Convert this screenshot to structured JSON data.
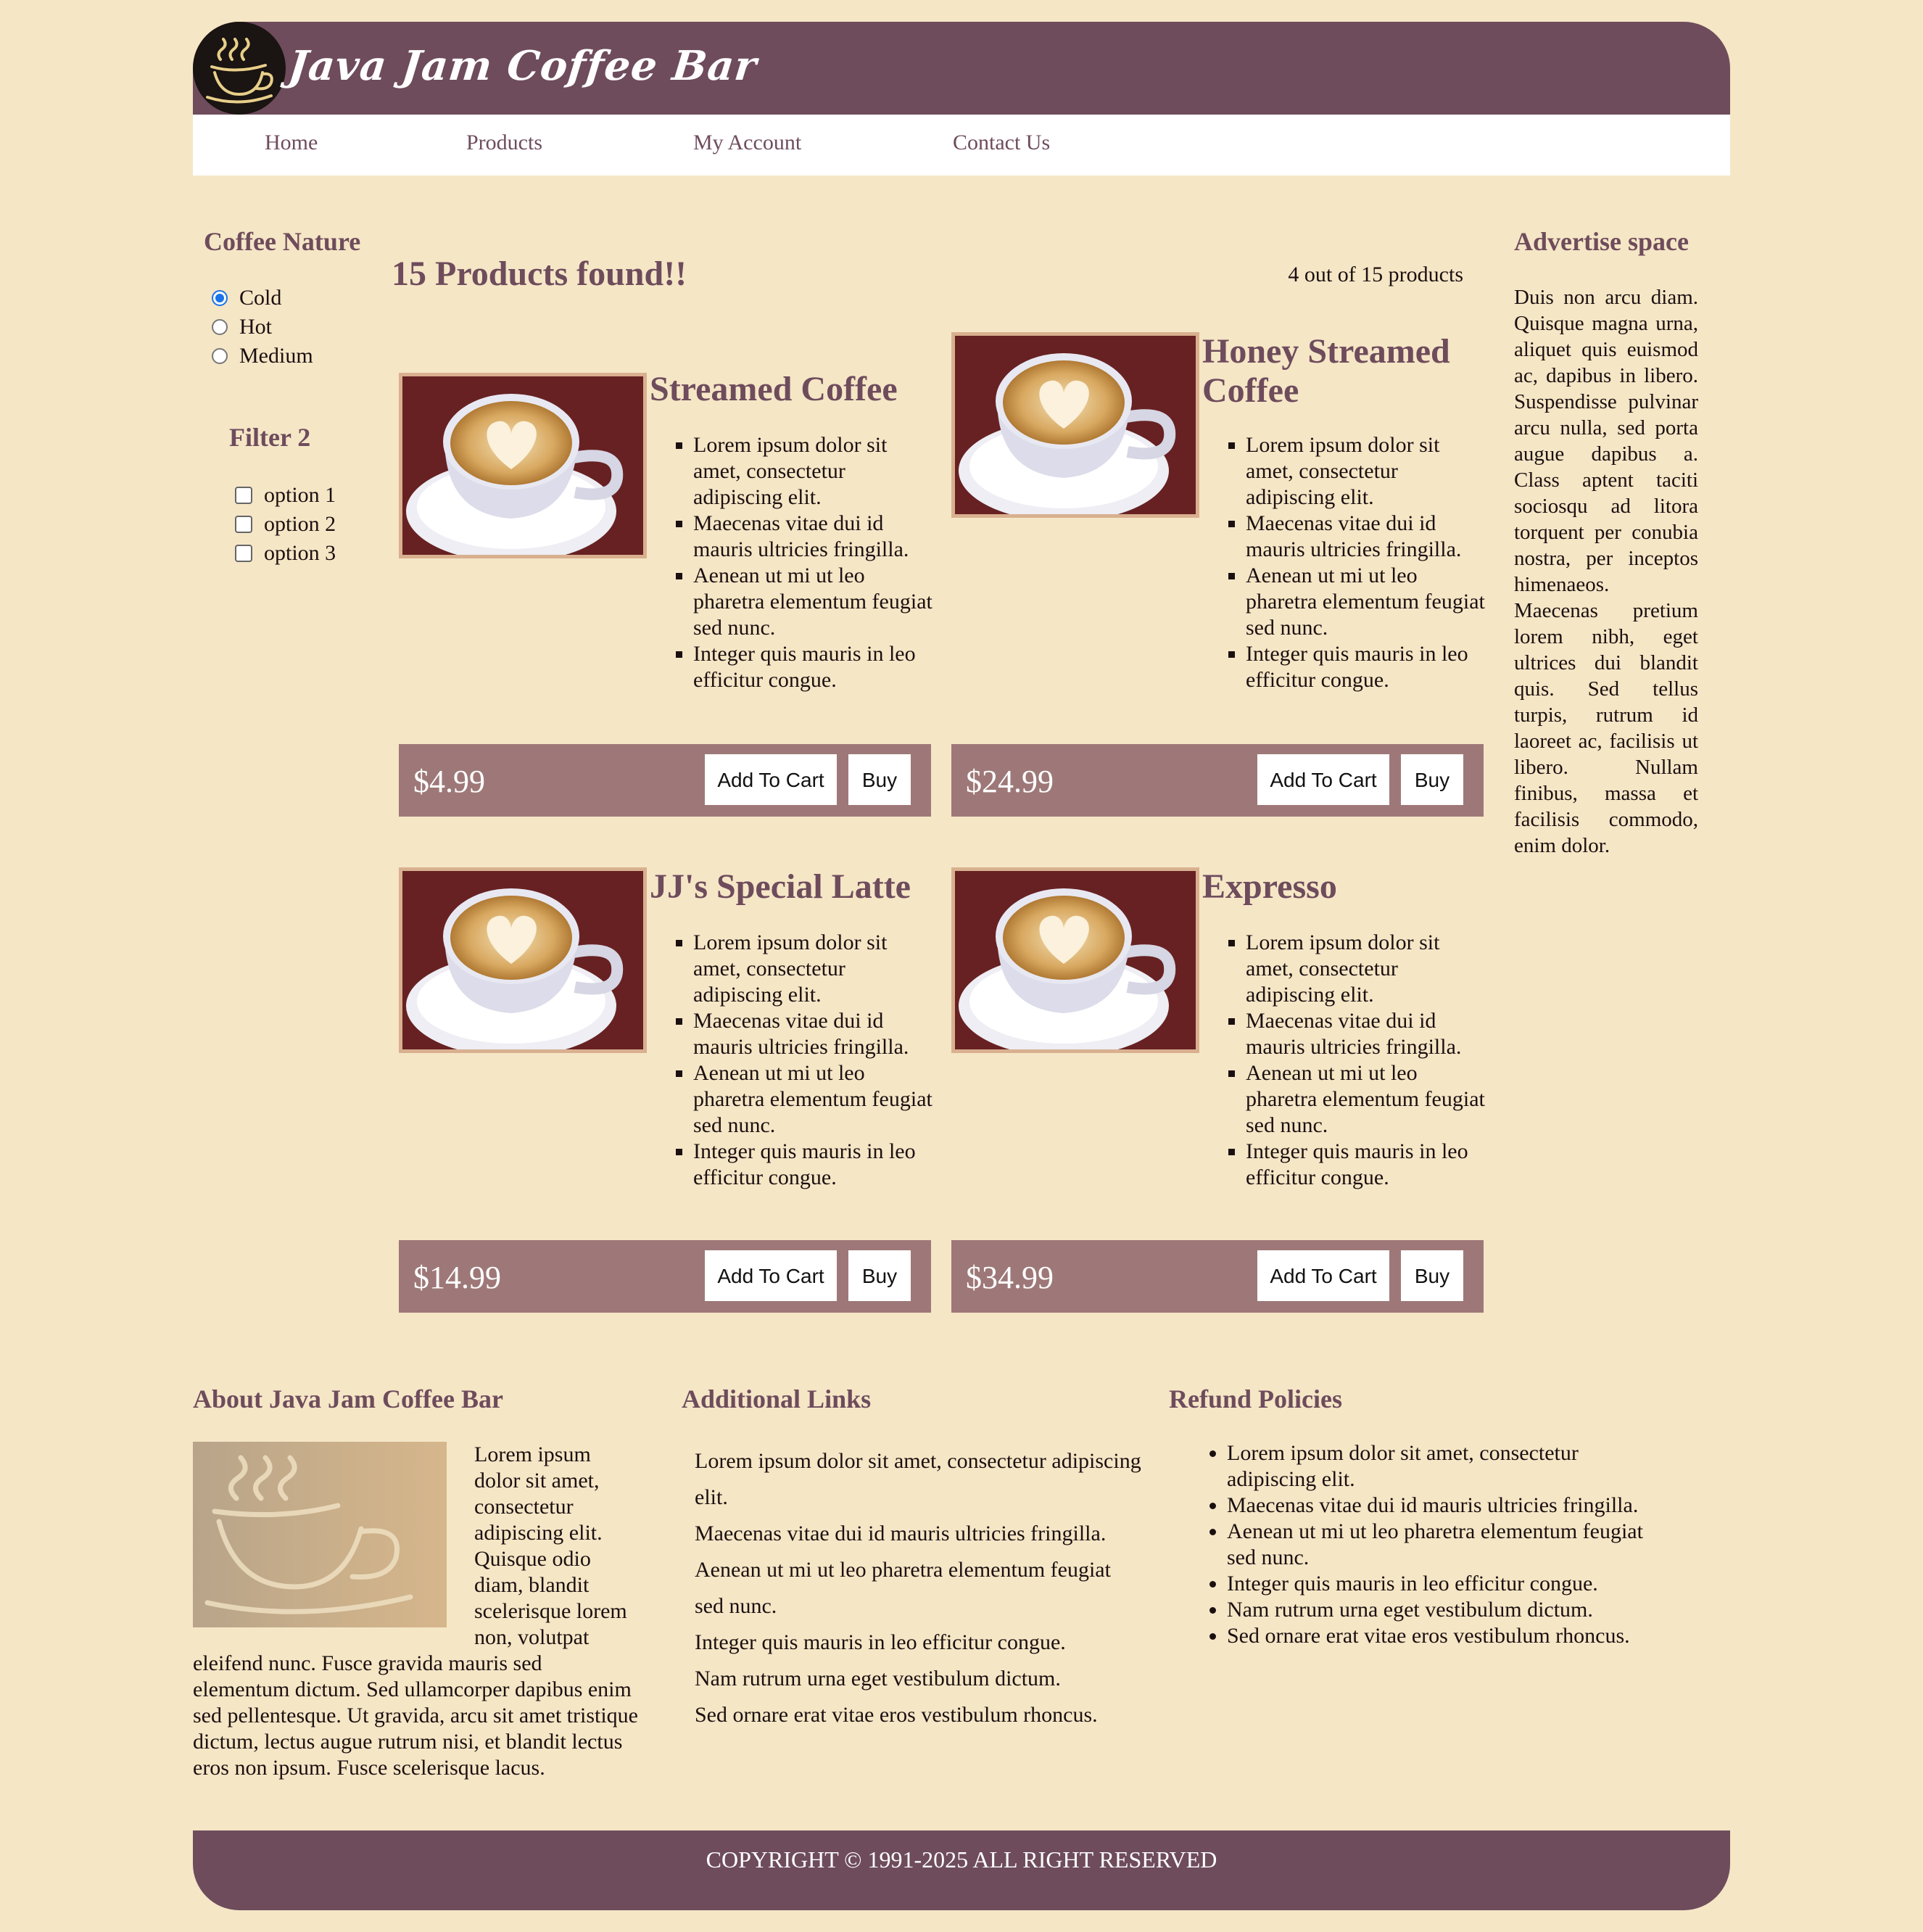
{
  "brand": {
    "title": "Java Jam Coffee Bar"
  },
  "nav": {
    "items": [
      "Home",
      "Products",
      "My Account",
      "Contact Us"
    ]
  },
  "filters": {
    "heading": "Coffee Nature",
    "radios": [
      {
        "label": "Cold",
        "checked": true
      },
      {
        "label": "Hot",
        "checked": false
      },
      {
        "label": "Medium",
        "checked": false
      }
    ],
    "filter2_heading": "Filter 2",
    "checkboxes": [
      {
        "label": "option 1",
        "checked": false
      },
      {
        "label": "option 2",
        "checked": false
      },
      {
        "label": "option 3",
        "checked": false
      }
    ]
  },
  "main": {
    "products_found": "15 Products found!!",
    "products_count": "4 out of 15 products",
    "add_to_cart_label": "Add To Cart",
    "buy_label": "Buy",
    "products": [
      {
        "name": "Streamed Coffee",
        "price": "$4.99",
        "features": [
          "Lorem ipsum dolor sit amet, consectetur adipiscing elit.",
          "Maecenas vitae dui id mauris ultricies fringilla.",
          "Aenean ut mi ut leo pharetra elementum feugiat sed nunc.",
          "Integer quis mauris in leo efficitur congue."
        ]
      },
      {
        "name": "Honey Streamed Coffee",
        "price": "$24.99",
        "features": [
          "Lorem ipsum dolor sit amet, consectetur adipiscing elit.",
          "Maecenas vitae dui id mauris ultricies fringilla.",
          "Aenean ut mi ut leo pharetra elementum feugiat sed nunc.",
          "Integer quis mauris in leo efficitur congue."
        ]
      },
      {
        "name": "JJ's Special Latte",
        "price": "$14.99",
        "features": [
          "Lorem ipsum dolor sit amet, consectetur adipiscing elit.",
          "Maecenas vitae dui id mauris ultricies fringilla.",
          "Aenean ut mi ut leo pharetra elementum feugiat sed nunc.",
          "Integer quis mauris in leo efficitur congue."
        ]
      },
      {
        "name": "Expresso",
        "price": "$34.99",
        "features": [
          "Lorem ipsum dolor sit amet, consectetur adipiscing elit.",
          "Maecenas vitae dui id mauris ultricies fringilla.",
          "Aenean ut mi ut leo pharetra elementum feugiat sed nunc.",
          "Integer quis mauris in leo efficitur congue."
        ]
      }
    ]
  },
  "advert": {
    "heading": "Advertise space",
    "text": "Duis non arcu diam. Quisque magna urna, aliquet quis euismod ac, dapibus in libero. Suspendisse pulvinar arcu nulla, sed porta augue dapibus a. Class aptent taciti sociosqu ad litora torquent per conubia nostra, per inceptos himenaeos. Maecenas pretium lorem nibh, eget ultrices dui blandit quis. Sed tellus turpis, rutrum id laoreet ac, facilisis ut libero. Nullam finibus, massa et facilisis commodo, enim dolor."
  },
  "footer_sections": {
    "about_heading": "About Java Jam Coffee Bar",
    "about_text": "Lorem ipsum dolor sit amet, consectetur adipiscing elit. Quisque odio diam, blandit scelerisque lorem non, volutpat eleifend nunc. Fusce gravida mauris sed elementum dictum. Sed ullamcorper dapibus enim sed pellentesque. Ut gravida, arcu sit amet tristique dictum, lectus augue rutrum nisi, et blandit lectus eros non ipsum. Fusce scelerisque lacus.",
    "links_heading": "Additional Links",
    "links": [
      "Lorem ipsum dolor sit amet, consectetur adipiscing elit.",
      "Maecenas vitae dui id mauris ultricies fringilla.",
      "Aenean ut mi ut leo pharetra elementum feugiat sed nunc.",
      "Integer quis mauris in leo efficitur congue.",
      "Nam rutrum urna eget vestibulum dictum.",
      "Sed ornare erat vitae eros vestibulum rhoncus."
    ],
    "refund_heading": "Refund Policies",
    "refund_items": [
      "Lorem ipsum dolor sit amet, consectetur adipiscing elit.",
      "Maecenas vitae dui id mauris ultricies fringilla.",
      "Aenean ut mi ut leo pharetra elementum feugiat sed nunc.",
      "Integer quis mauris in leo efficitur congue.",
      "Nam rutrum urna eget vestibulum dictum.",
      "Sed ornare erat vitae eros vestibulum rhoncus."
    ]
  },
  "footer": {
    "copyright": "COPYRIGHT © 1991-2025 ALL RIGHT RESERVED"
  },
  "colors": {
    "background": "#f5e6c6",
    "brand_purple": "#6e4c5c",
    "price_bar": "#9e7878",
    "image_border": "#d9b08f",
    "radio_accent": "#1a73e8"
  },
  "icons": {
    "logo": "coffee-cup-logo-icon",
    "product_image": "latte-cup-image"
  }
}
